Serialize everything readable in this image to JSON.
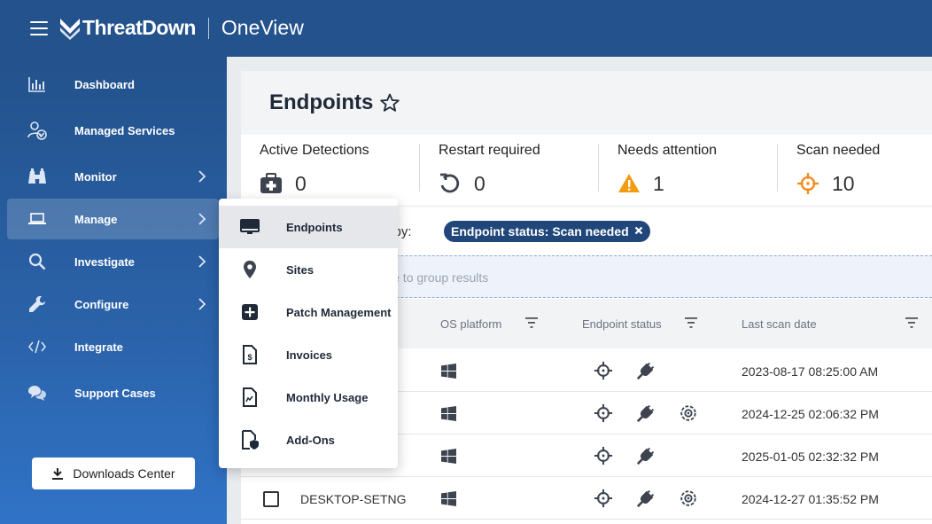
{
  "header": {
    "brand_name": "ThreatDown",
    "product_name": "OneView"
  },
  "sidebar": {
    "items": [
      {
        "label": "Dashboard",
        "icon": "bar-chart-icon"
      },
      {
        "label": "Managed Services",
        "icon": "user-check-icon"
      },
      {
        "label": "Monitor",
        "icon": "binoculars-icon"
      },
      {
        "label": "Manage",
        "icon": "laptop-icon"
      },
      {
        "label": "Investigate",
        "icon": "search-icon"
      },
      {
        "label": "Configure",
        "icon": "wrench-icon"
      },
      {
        "label": "Integrate",
        "icon": "code-icon"
      },
      {
        "label": "Support Cases",
        "icon": "chat-icon"
      }
    ],
    "downloads_label": "Downloads Center"
  },
  "manage_menu": {
    "items": [
      {
        "label": "Endpoints",
        "icon": "monitor-icon"
      },
      {
        "label": "Sites",
        "icon": "location-pin-icon"
      },
      {
        "label": "Patch Management",
        "icon": "plus-square-icon"
      },
      {
        "label": "Invoices",
        "icon": "invoice-icon"
      },
      {
        "label": "Monthly Usage",
        "icon": "usage-doc-icon"
      },
      {
        "label": "Add-Ons",
        "icon": "addon-doc-icon"
      }
    ]
  },
  "page": {
    "title": "Endpoints"
  },
  "stats": [
    {
      "label": "Active Detections",
      "value": "0",
      "icon": "medkit-icon"
    },
    {
      "label": "Restart required",
      "value": "0",
      "icon": "restart-icon"
    },
    {
      "label": "Needs attention",
      "value": "1",
      "icon": "warning-icon"
    },
    {
      "label": "Scan needed",
      "value": "10",
      "icon": "crosshair-icon"
    }
  ],
  "filter": {
    "label_fragment": "d by:",
    "chip": "Endpoint status: Scan needed"
  },
  "group_hint": "s here to group results",
  "table": {
    "columns": [
      "OS platform",
      "Endpoint status",
      "Last scan date"
    ],
    "rows": [
      {
        "hostname": "",
        "date": "2023-08-17 08:25:00 AM",
        "third_icon": false
      },
      {
        "hostname": "",
        "date": "2024-12-25 02:06:32 PM",
        "third_icon": true
      },
      {
        "hostname": "",
        "date": "2025-01-05 02:32:32 PM",
        "third_icon": false
      },
      {
        "hostname": "DESKTOP-SETNG",
        "date": "2024-12-27 01:35:52 PM",
        "third_icon": true
      }
    ]
  },
  "colors": {
    "header_bg": "#23528c",
    "chip_bg": "#21477a",
    "warning": "#f39c12",
    "scan_orange": "#f08c1c"
  }
}
